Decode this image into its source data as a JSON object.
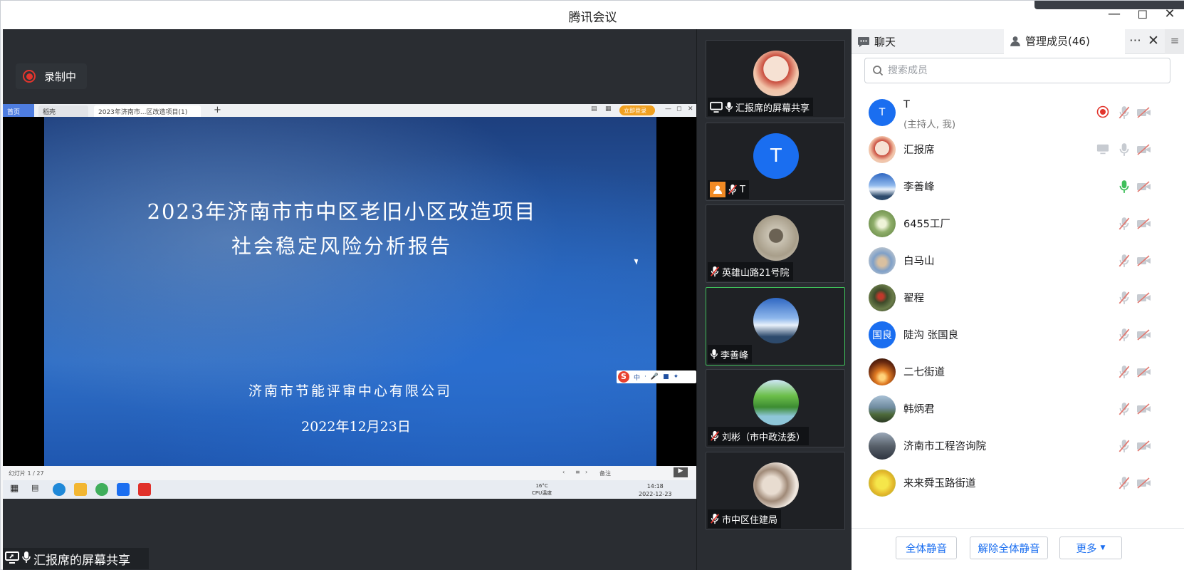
{
  "window": {
    "title": "腾讯会议"
  },
  "recording": {
    "label": "录制中"
  },
  "shared_screen": {
    "browser_tabs": [
      "首页",
      "稻壳",
      "2023年济南市...区改造项目(1)"
    ],
    "login_button": "立即登录",
    "slide": {
      "title_line1": "2023年济南市市中区老旧小区改造项目",
      "title_line2": "社会稳定风险分析报告",
      "organization": "济南市节能评审中心有限公司",
      "date": "2022年12月23日"
    },
    "status_left": "幻灯片 1 / 27",
    "status_note": "备注",
    "taskbar": {
      "temp": "16°C",
      "cpu": "CPU温度",
      "time": "14:18",
      "date": "2022-12-23"
    },
    "ime": [
      "中",
      "·",
      "·"
    ]
  },
  "share_label": "汇报席的屏幕共享",
  "video_tiles": [
    {
      "label": "汇报席的屏幕共享",
      "avatar": "anime-avatar"
    },
    {
      "label": "T",
      "avatar": "T"
    },
    {
      "label": "英雄山路21号院",
      "avatar": "photo-avatar"
    },
    {
      "label": "李善峰",
      "avatar": "sky-avatar"
    },
    {
      "label": "刘彬（市中政法委）",
      "avatar": "landscape-avatar"
    },
    {
      "label": "市中区住建局",
      "avatar": "photo-avatar"
    }
  ],
  "panel": {
    "tab_chat": "聊天",
    "tab_members": "管理成员(46)",
    "search_placeholder": "搜索成员",
    "members": [
      {
        "name": "T",
        "sub": "(主持人, 我)",
        "avatar_text": "T",
        "avatar_color": "#1a6ef0"
      },
      {
        "name": "汇报席",
        "sub": "",
        "avatar_text": "",
        "avatar_color": "#f4d9c8"
      },
      {
        "name": "李善峰",
        "sub": "",
        "avatar_text": "",
        "avatar_color": "#3b6fb6"
      },
      {
        "name": "6455工厂",
        "sub": "",
        "avatar_text": "",
        "avatar_color": "#8fae6a"
      },
      {
        "name": "白马山",
        "sub": "",
        "avatar_text": "",
        "avatar_color": "#b9a58c"
      },
      {
        "name": "翟程",
        "sub": "",
        "avatar_text": "",
        "avatar_color": "#3d4a2a"
      },
      {
        "name": "陡沟 张国良",
        "sub": "",
        "avatar_text": "国良",
        "avatar_color": "#1a6ef0"
      },
      {
        "name": "二七街道",
        "sub": "",
        "avatar_text": "",
        "avatar_color": "#a0541c"
      },
      {
        "name": "韩炳君",
        "sub": "",
        "avatar_text": "",
        "avatar_color": "#6e8a9e"
      },
      {
        "name": "济南市工程咨询院",
        "sub": "",
        "avatar_text": "",
        "avatar_color": "#58606a"
      },
      {
        "name": "来来舜玉路街道",
        "sub": "",
        "avatar_text": "",
        "avatar_color": "#e3d53a"
      }
    ],
    "footer": {
      "mute_all": "全体静音",
      "unmute_all": "解除全体静音",
      "more": "更多"
    }
  }
}
